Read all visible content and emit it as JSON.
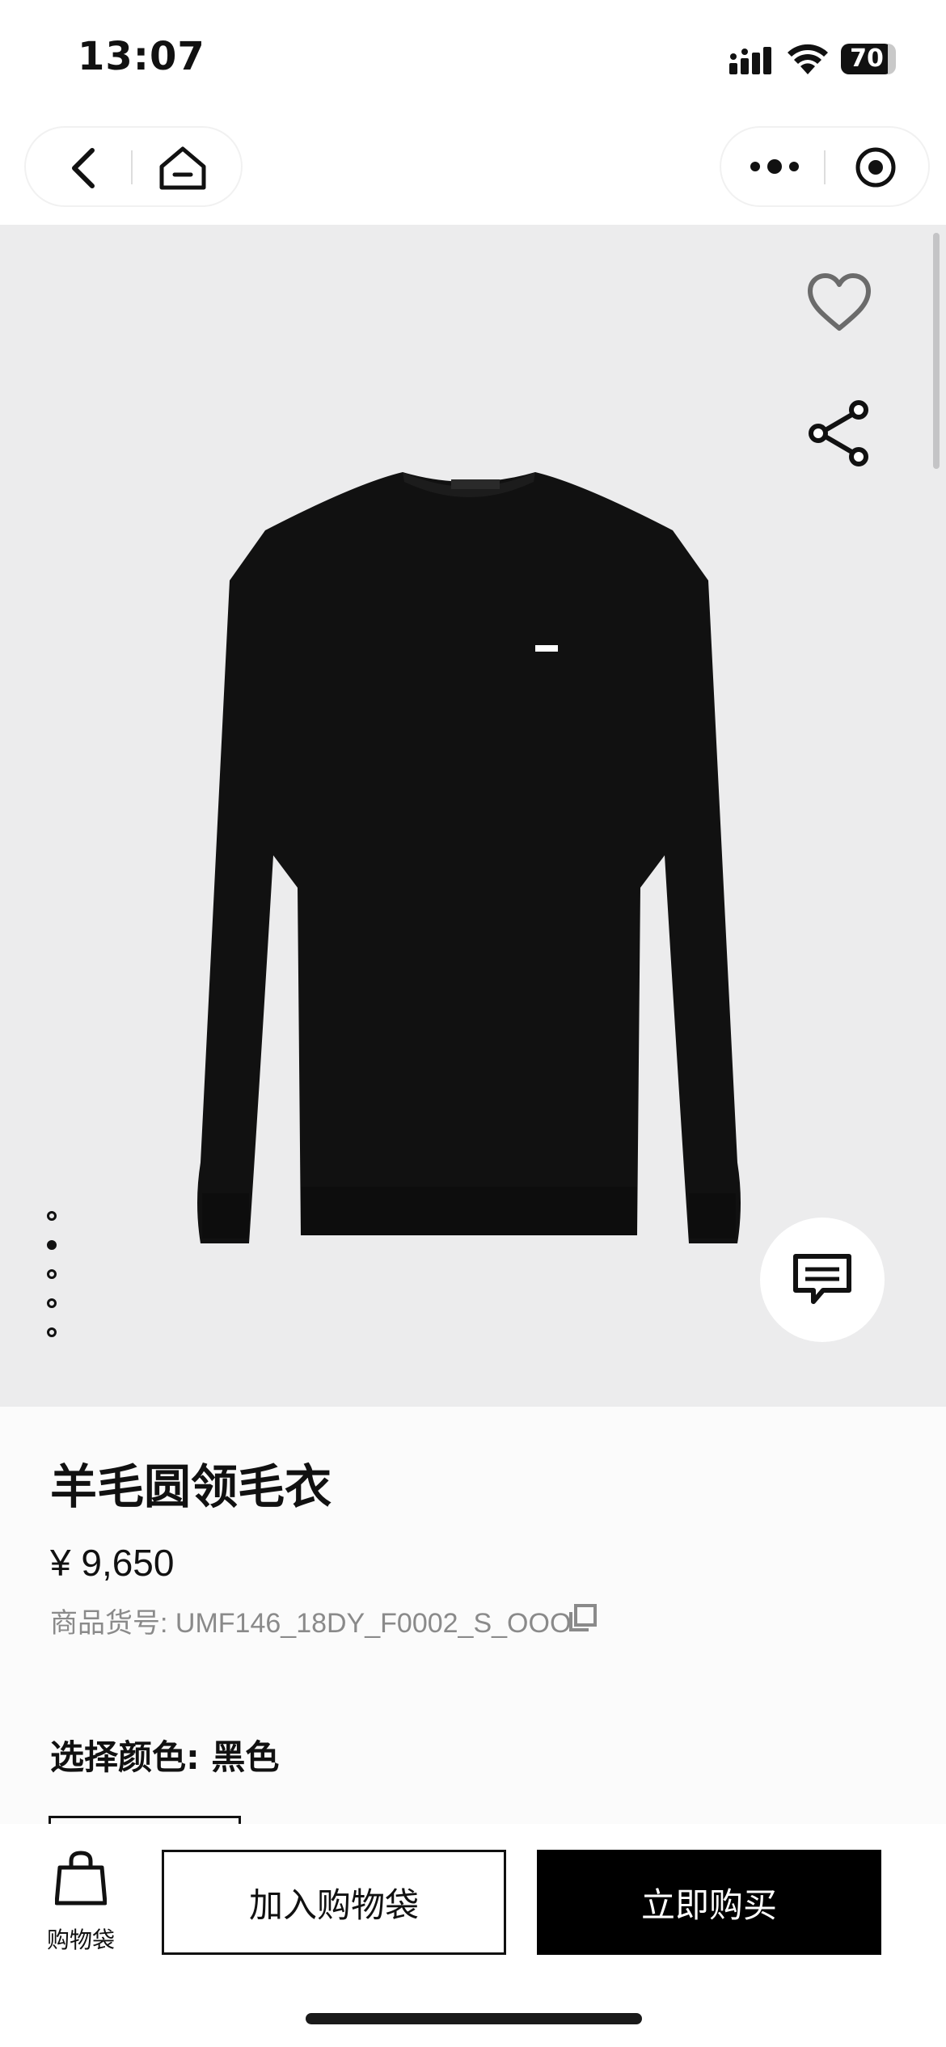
{
  "status_bar": {
    "time": "13:07",
    "battery": "70",
    "icons": [
      "signal-icon",
      "wifi-icon",
      "battery-icon"
    ]
  },
  "nav": {
    "left": [
      "back-icon",
      "home-icon"
    ],
    "right": [
      "more-icon",
      "target-icon"
    ]
  },
  "hero": {
    "image": "black crew-neck sweater",
    "actions": [
      "heart-icon",
      "share-icon"
    ],
    "carousel": {
      "count": 5,
      "active_index": 1
    },
    "chat_icon": "chat-icon"
  },
  "product": {
    "title": "羊毛圆领毛衣",
    "price": "¥ 9,650",
    "sku_label": "商品货号: ",
    "sku_value": "UMF146_18DY_F0002_S_OOO",
    "color_label": "选择颜色: ",
    "color_value": "黑色"
  },
  "bottom_bar": {
    "bag_label": "购物袋",
    "add_to_bag": "加入购物袋",
    "buy_now": "立即购买"
  }
}
